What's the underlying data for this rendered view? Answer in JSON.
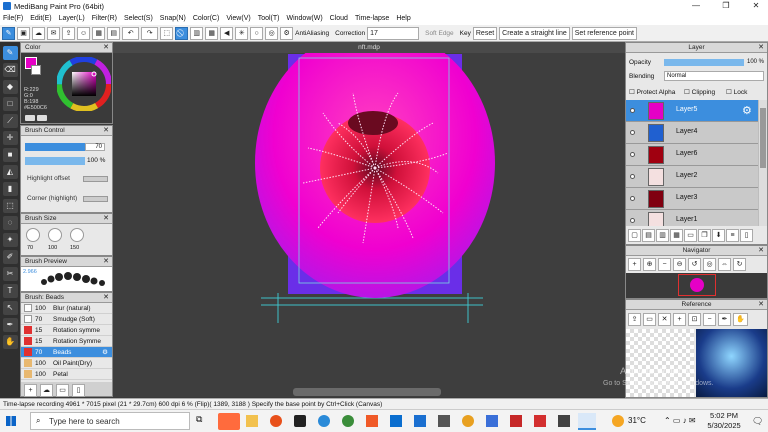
{
  "window": {
    "title": "MediBang Paint Pro (64bit)",
    "min": "—",
    "max": "❐",
    "close": "✕"
  },
  "menu": [
    "File(F)",
    "Edit(E)",
    "Layer(L)",
    "Filter(R)",
    "Select(S)",
    "Snap(N)",
    "Color(C)",
    "View(V)",
    "Tool(T)",
    "Window(W)",
    "Cloud",
    "Time-lapse",
    "Help"
  ],
  "toolbar": {
    "antialiasing": "AntiAliasing",
    "correction_label": "Correction",
    "correction_value": "17",
    "soft_edge": "Soft Edge",
    "key": "Key",
    "reset": "Reset",
    "straight_line": "Create a straight line",
    "reference_point": "Set reference point"
  },
  "color_panel": {
    "title": "Color",
    "r": "R:229",
    "g": "G:0",
    "b": "B:198",
    "hex": "#E500C6"
  },
  "brush_control": {
    "title": "Brush Control",
    "size": "70",
    "opacity": "100 %",
    "highlight_offset": "Highlight offset",
    "corner": "Corner (highlight)"
  },
  "brush_size": {
    "title": "Brush Size",
    "sizes": [
      "70",
      "100",
      "150"
    ]
  },
  "brush_preview": {
    "title": "Brush Preview",
    "value": "2.966"
  },
  "brush_list": {
    "title": "Brush: Beads",
    "items": [
      {
        "num": "100",
        "name": "Blur (natural)",
        "color": "#ffffff"
      },
      {
        "num": "70",
        "name": "Smudge (Soft)",
        "color": "#ffffff"
      },
      {
        "num": "15",
        "name": "Rotation symme",
        "color": "#e03030"
      },
      {
        "num": "15",
        "name": "Rotation Symme",
        "color": "#e03030"
      },
      {
        "num": "70",
        "name": "Beads",
        "color": "#e03030"
      },
      {
        "num": "100",
        "name": "Oil Paint(Dry)",
        "color": "#e8b870"
      },
      {
        "num": "100",
        "name": "Petal",
        "color": "#e8b870"
      }
    ]
  },
  "document": {
    "tab": "nft.mdp"
  },
  "layer_panel": {
    "title": "Layer",
    "opacity_label": "Opacity",
    "opacity_value": "100 %",
    "blending_label": "Blending",
    "blending_value": "Normal",
    "protect_alpha": "Protect Alpha",
    "clipping": "Clipping",
    "lock": "Lock",
    "layers": [
      "Layer5",
      "Layer4",
      "Layer6",
      "Layer2",
      "Layer3",
      "Layer1"
    ]
  },
  "navigator": {
    "title": "Navigator"
  },
  "reference": {
    "title": "Reference"
  },
  "watermark": {
    "line1": "Activate Windows",
    "line2": "Go to Settings to activate Windows."
  },
  "status": "Time-lapse recording  4961 * 7015 pixel  (21 * 29.7cm)  600 dpi  6 %  (Flip)( 1389, 3188 )  Specify the base point by Ctrl+Click (Canvas)",
  "taskbar": {
    "search": "Type here to search",
    "temp": "31°C",
    "time": "5:02 PM",
    "date": "5/30/2025"
  },
  "colors": {
    "accent": "#3c8ede",
    "magenta": "#e500c6"
  }
}
